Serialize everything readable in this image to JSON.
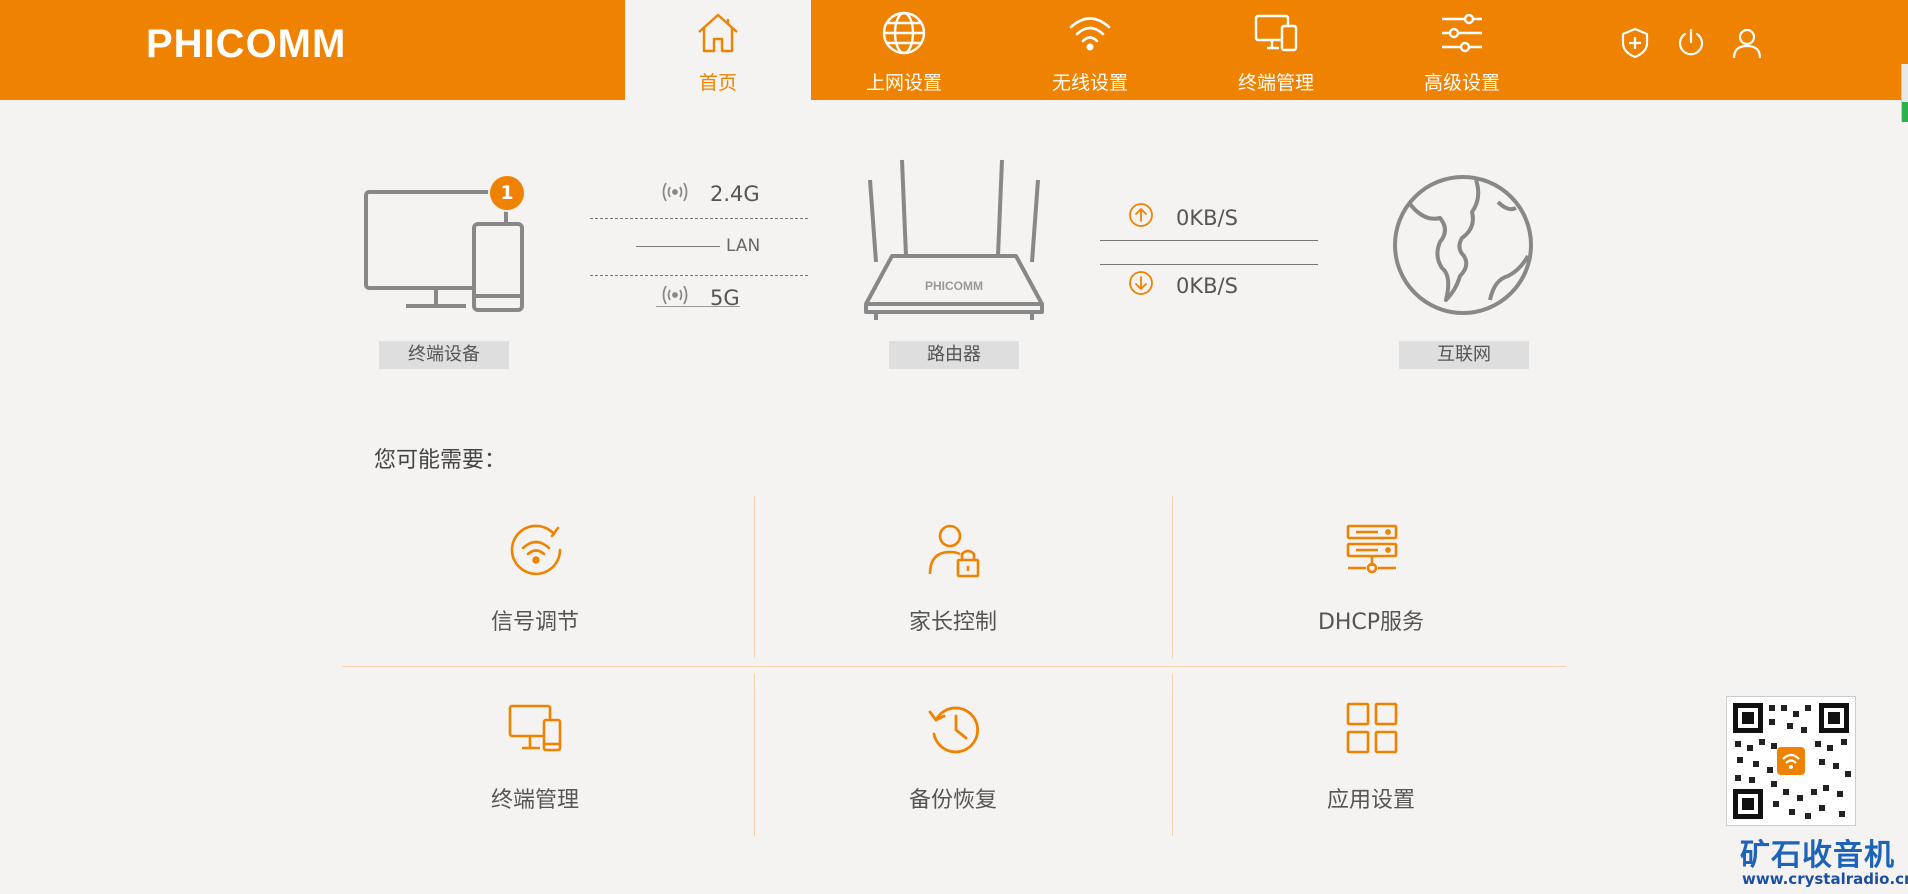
{
  "brand": {
    "logo": "PHICOMM",
    "accent": "#ef8200"
  },
  "nav": {
    "tabs": [
      {
        "label": "首页",
        "icon": "home-icon",
        "active": true
      },
      {
        "label": "上网设置",
        "icon": "globe-icon"
      },
      {
        "label": "无线设置",
        "icon": "wifi-icon"
      },
      {
        "label": "终端管理",
        "icon": "devices-icon"
      },
      {
        "label": "高级设置",
        "icon": "sliders-icon"
      }
    ],
    "right_icons": [
      "shield-plus-icon",
      "power-icon",
      "user-icon"
    ]
  },
  "topology": {
    "devices": {
      "label": "终端设备",
      "badge": "1",
      "icon": "monitor-phone-icon"
    },
    "wifi_24": "2.4G",
    "lan": "LAN",
    "wifi_5": "5G",
    "router": {
      "label": "路由器",
      "brand_text": "PHICOMM",
      "icon": "router-icon"
    },
    "upload": "0KB/S",
    "download": "0KB/S",
    "internet": {
      "label": "互联网",
      "icon": "globe-icon"
    }
  },
  "quick": {
    "title": "您可能需要：",
    "items": [
      {
        "label": "信号调节",
        "icon": "signal-adjust-icon"
      },
      {
        "label": "家长控制",
        "icon": "parental-lock-icon"
      },
      {
        "label": "DHCP服务",
        "icon": "server-icon"
      },
      {
        "label": "终端管理",
        "icon": "devices-icon"
      },
      {
        "label": "备份恢复",
        "icon": "history-icon"
      },
      {
        "label": "应用设置",
        "icon": "apps-grid-icon"
      }
    ]
  },
  "watermark": {
    "name": "矿石收音机",
    "url": "www.crystalradio.cn",
    "qr_icon": "qr-code-icon"
  }
}
